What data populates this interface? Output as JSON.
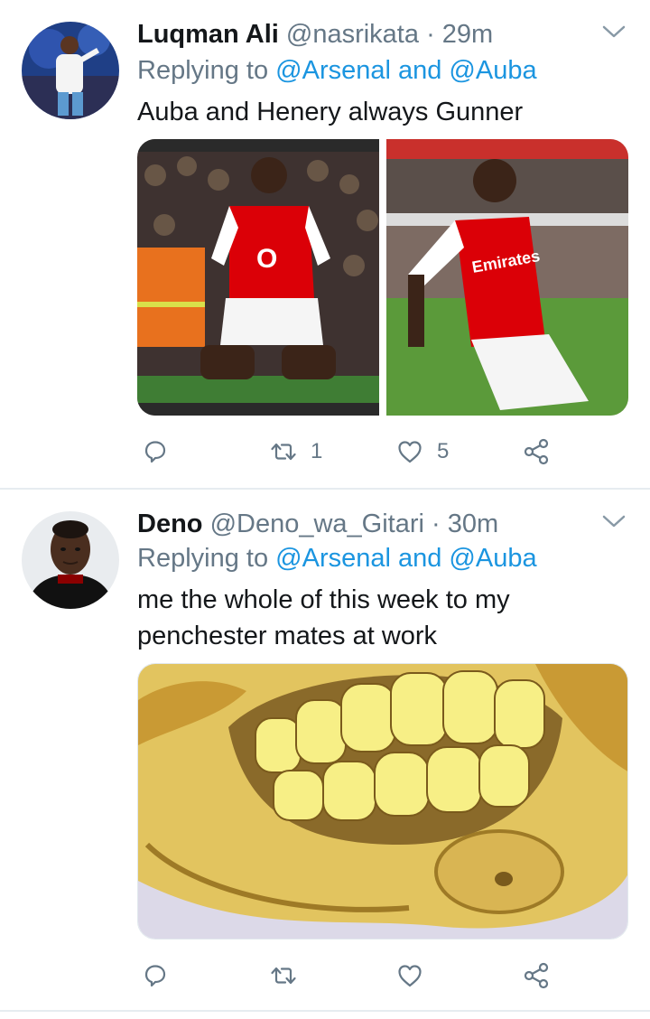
{
  "tweets": [
    {
      "name": "Luqman Ali",
      "handle": "@nasrikata",
      "separator": "·",
      "time": "29m",
      "replying_prefix": "Replying to",
      "replying_targets": "@Arsenal and @Auba",
      "text": "Auba and Henery  always Gunner",
      "media": [
        "player-kneeling-celebration-photo",
        "player-sliding-celebration-photo"
      ],
      "actions": {
        "reply_count": "",
        "retweet_count": "1",
        "like_count": "5"
      }
    },
    {
      "name": "Deno",
      "handle": "@Deno_wa_Gitari",
      "separator": "·",
      "time": "30m",
      "replying_prefix": "Replying to",
      "replying_targets": "@Arsenal and @Auba",
      "text_line1": "me the whole of this week to my",
      "text_line2": "penchester mates at work",
      "media": [
        "grinning-face-meme-image"
      ],
      "actions": {
        "reply_count": "",
        "retweet_count": "",
        "like_count": ""
      }
    }
  ],
  "colors": {
    "link": "#1b95e0",
    "secondary": "#657786",
    "divider": "#e6ecf0",
    "arsenal_red": "#db0007"
  },
  "icons": [
    "chevron-down-icon",
    "reply-icon",
    "retweet-icon",
    "like-icon",
    "share-icon"
  ]
}
